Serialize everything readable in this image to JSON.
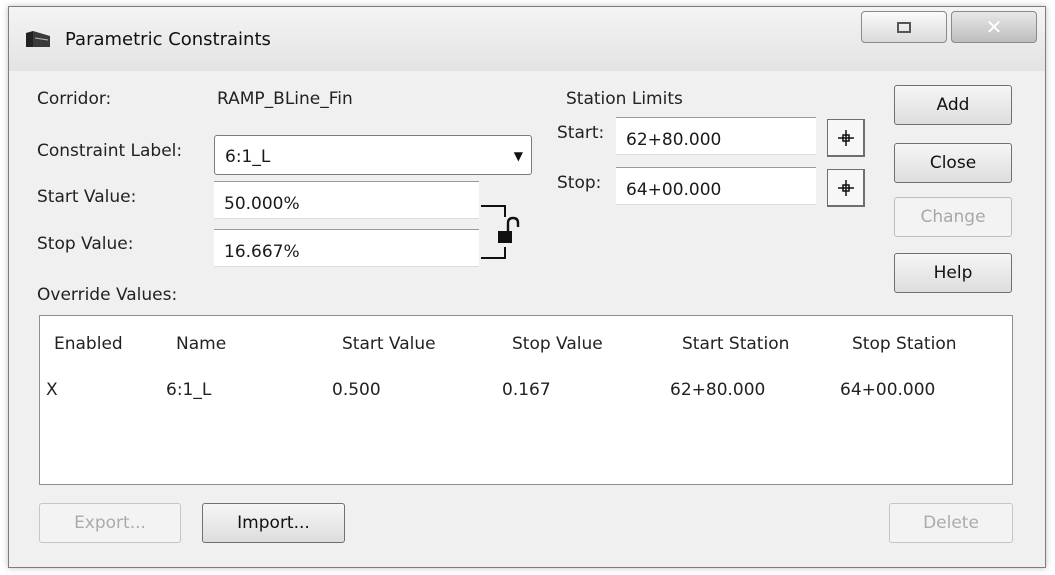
{
  "window": {
    "title": "Parametric Constraints"
  },
  "form": {
    "corridor_label": "Corridor:",
    "corridor_value": "RAMP_BLine_Fin",
    "constraint_label": "Constraint Label:",
    "constraint_selected": "6:1_L",
    "start_value_label": "Start Value:",
    "start_value": "50.000%",
    "stop_value_label": "Stop Value:",
    "stop_value": "16.667%"
  },
  "station_limits": {
    "heading": "Station Limits",
    "start_label": "Start:",
    "start_value": "62+80.000",
    "stop_label": "Stop:",
    "stop_value": "64+00.000"
  },
  "buttons": {
    "add": "Add",
    "close": "Close",
    "change": "Change",
    "help": "Help",
    "export": "Export...",
    "import": "Import...",
    "delete": "Delete"
  },
  "override": {
    "label": "Override Values:",
    "columns": [
      "Enabled",
      "Name",
      "Start Value",
      "Stop Value",
      "Start Station",
      "Stop Station"
    ],
    "rows": [
      [
        "X",
        "6:1_L",
        "0.500",
        "0.167",
        "62+80.000",
        "64+00.000"
      ]
    ]
  },
  "icons": {
    "app": "corridor-app-icon",
    "lock": "lock-icon",
    "pick": "crosshair-pick-icon"
  }
}
